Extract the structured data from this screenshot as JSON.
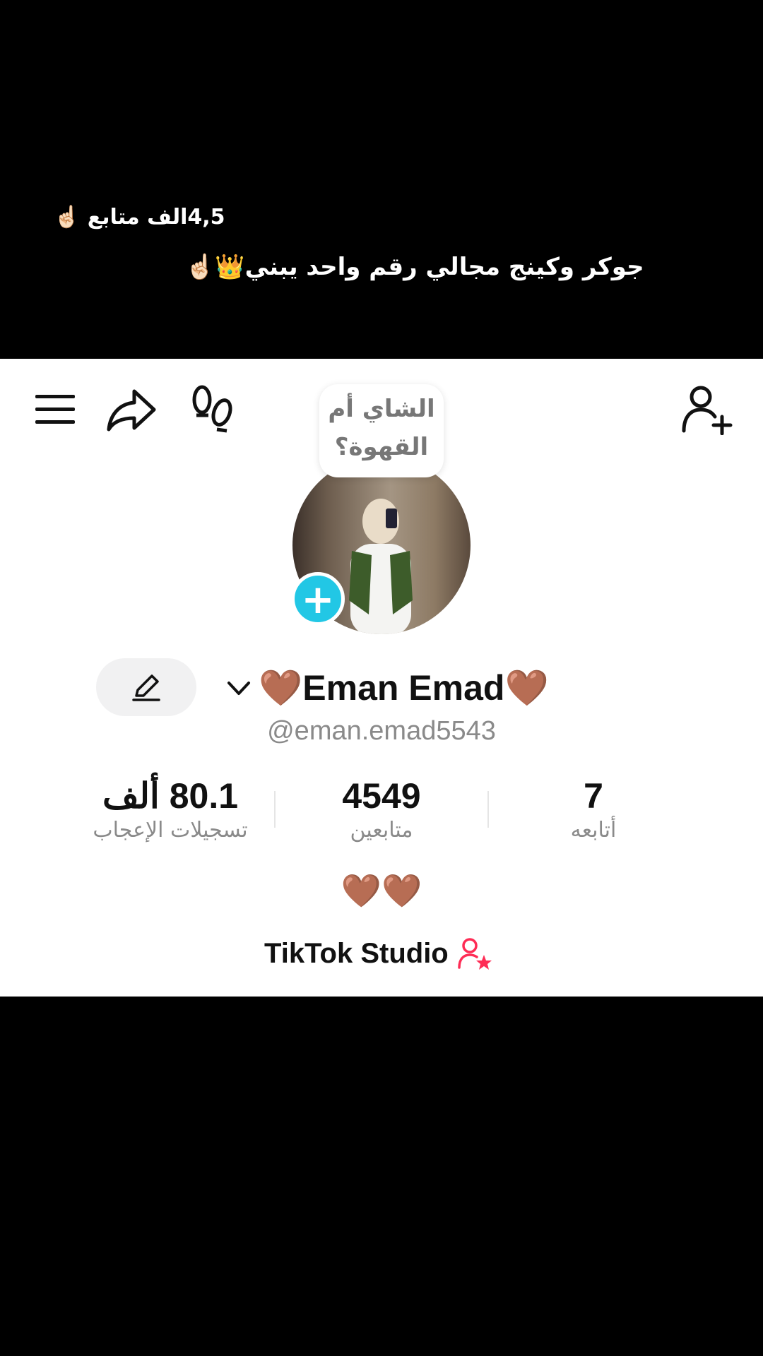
{
  "overlay": {
    "line1": "4,5الف متابع ☝🏻",
    "line2": "جوكر وكينج مجالي رقم واحد يبني👑☝🏻"
  },
  "profile": {
    "note_bubble": "الشاي أم القهوة؟",
    "display_name": "🤎Eman Emad🤎",
    "username": "@eman.emad5543",
    "stats": {
      "likes_value": "80.1 ألف",
      "likes_label": "تسجيلات الإعجاب",
      "followers_value": "4549",
      "followers_label": "متابعين",
      "following_value": "7",
      "following_label": "أتابعه"
    },
    "bio": "🤎🤎",
    "studio_label": "TikTok Studio"
  },
  "icons": {
    "menu": "menu-icon",
    "share": "share-icon",
    "footsteps": "footsteps-icon",
    "add_friend": "add-friend-icon",
    "edit": "pencil-icon",
    "chevron": "chevron-down-icon",
    "add_avatar": "plus-icon",
    "studio": "creator-star-icon"
  },
  "colors": {
    "accent_cyan": "#22c7e5",
    "studio_pink": "#fe2c55",
    "text_secondary": "#8a8a8a"
  }
}
